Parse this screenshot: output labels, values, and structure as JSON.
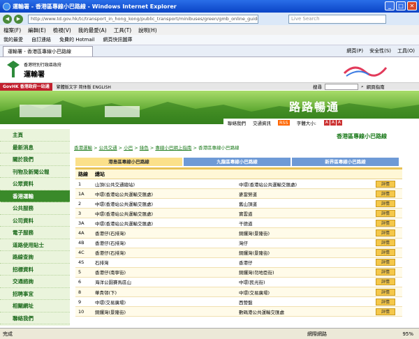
{
  "window": {
    "title": "運輸署 - 香港區專線小巴路線 - Windows Internet Explorer"
  },
  "address": {
    "url": "http://www.td.gov.hk/tc/transport_in_hong_kong/public_transport/minibuses/green/gmb_online_guide/hong_kong_isl",
    "search_placeholder": "Live Search"
  },
  "menu": [
    "檔案(F)",
    "編輯(E)",
    "檢視(V)",
    "我的最愛(A)",
    "工具(T)",
    "說明(H)"
  ],
  "favorites": [
    "我的最愛",
    "自訂連結",
    "免費的 Hotmail",
    "網頁快訊圖庫"
  ],
  "tab": {
    "label": "運輸署 - 香港區專線小巴路線"
  },
  "tab_tools": [
    "網頁(P)",
    "安全性(S)",
    "工具(O)"
  ],
  "header": {
    "dept_small": "香港特別行政區政府",
    "dept_name": "運輸署"
  },
  "govbar": {
    "govhk": "GovHK 香港政府一站通",
    "langs": "繁體版文字  简体版  ENGLISH",
    "search_label": "搜尋",
    "site_map": "網頁指南"
  },
  "banner": {
    "title": "路路暢通",
    "links": [
      "聯絡我們",
      "交通資訊",
      "RSS",
      "字體大小:"
    ]
  },
  "sidebar": [
    "主頁",
    "最新消息",
    "關於我們",
    "刊物及新聞公報",
    "公眾資料",
    "香港運輸",
    "公共服務",
    "公司資料",
    "電子服務",
    "道路使用貼士",
    "路線查詢",
    "招標資料",
    "交通諮詢",
    "招聘事宜",
    "相關網址",
    "聯絡我們"
  ],
  "sidebar_active": 5,
  "page_title": "香港區專線小巴路線",
  "breadcrumb": [
    "香港運輸",
    "公共交通",
    "小巴",
    "綠色",
    "專線小巴網上指南",
    "香港區專線小巴路線"
  ],
  "route_tabs": [
    "港島區專線小巴路線",
    "九龍區專線小巴路線",
    "新界區專線小巴路線"
  ],
  "table": {
    "headers": [
      "路線",
      "總站"
    ],
    "detail_label": "詳情",
    "rows": [
      {
        "route": "1",
        "from": "山頂(公共交通總站)",
        "to": "中環(香港站公共運輸交匯處)"
      },
      {
        "route": "1A",
        "from": "中環(香港站公共運輸交匯處)",
        "to": "麥當勞道"
      },
      {
        "route": "2",
        "from": "中環(香港站公共運輸交匯處)",
        "to": "舊山頂道"
      },
      {
        "route": "3",
        "from": "中環(香港站公共運輸交匯處)",
        "to": "寶雲道"
      },
      {
        "route": "3A",
        "from": "中環(香港站公共運輸交匯處)",
        "to": "干德道"
      },
      {
        "route": "4A",
        "from": "香港仔(石排灣)",
        "to": "銅鑼灣(景隆街)"
      },
      {
        "route": "4B",
        "from": "香港仔(石排灣)",
        "to": "灣仔"
      },
      {
        "route": "4C",
        "from": "香港仔(石排灣)",
        "to": "銅鑼灣(景隆街)"
      },
      {
        "route": "4S",
        "from": "石排灣",
        "to": "香港仔"
      },
      {
        "route": "5",
        "from": "香港仔(南寧街)",
        "to": "銅鑼灣(勿地臣街)"
      },
      {
        "route": "6",
        "from": "海洋公園賽馬區山",
        "to": "中環(民光街)"
      },
      {
        "route": "8",
        "from": "華貴邨(下)",
        "to": "中環(交易廣場)"
      },
      {
        "route": "9",
        "from": "中環(交易廣場)",
        "to": "西營盤"
      },
      {
        "route": "10",
        "from": "銅鑼灣(景隆街)",
        "to": "數碼港公共運輸交匯處"
      }
    ]
  },
  "status": {
    "left": "完成",
    "zone": "網際網路",
    "zoom": "95%"
  },
  "colors": {
    "green": "#3a8a2a",
    "gold": "#f5c84a",
    "blue_tab": "#6e9ad6"
  }
}
